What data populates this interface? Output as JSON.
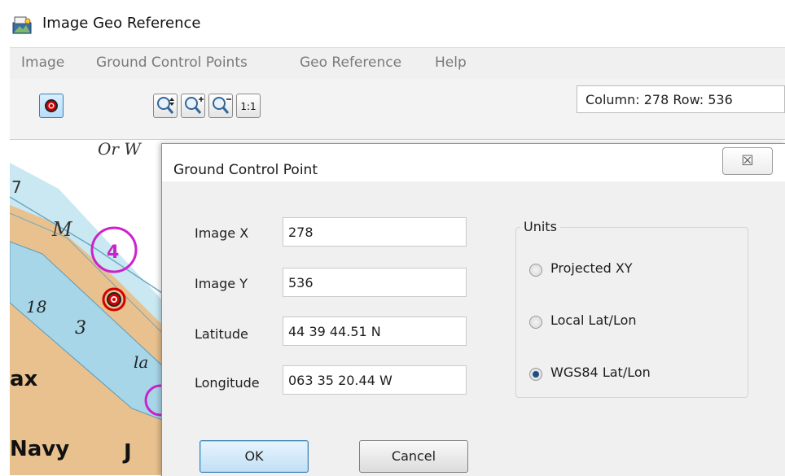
{
  "window": {
    "title": "Image Geo Reference"
  },
  "menu": [
    {
      "label": "Image"
    },
    {
      "label": "Ground Control Points"
    },
    {
      "label": "Geo Reference"
    },
    {
      "label": "Help"
    }
  ],
  "toolbar": {
    "zoom_actual_label": "1:1",
    "status_text": "Column: 278  Row: 536"
  },
  "map": {
    "labels": [
      "Or W",
      "7",
      "M",
      "4",
      "18",
      "3",
      "ax",
      "Navy",
      "la",
      "J"
    ]
  },
  "dialog": {
    "title": "Ground Control Point",
    "close_glyph": "☒",
    "fields": [
      {
        "label": "Image X",
        "value": "278"
      },
      {
        "label": "Image Y",
        "value": "536"
      },
      {
        "label": "Latitude",
        "value": "44 39 44.51 N"
      },
      {
        "label": "Longitude",
        "value": "063 35 20.44 W"
      }
    ],
    "units": {
      "legend": "Units",
      "options": [
        {
          "label": "Projected XY",
          "checked": false
        },
        {
          "label": "Local Lat/Lon",
          "checked": false
        },
        {
          "label": "WGS84 Lat/Lon",
          "checked": true
        }
      ]
    },
    "ok_label": "OK",
    "cancel_label": "Cancel"
  },
  "colors": {
    "land": "#e8c18e",
    "shallow_water": "#bfe2ee",
    "channel": "#a7d6e8",
    "magenta_marker": "#cc22cc",
    "target_red": "#d40000",
    "radio_selected": "#1d4f86",
    "button_accent": "#3c7fb1"
  }
}
